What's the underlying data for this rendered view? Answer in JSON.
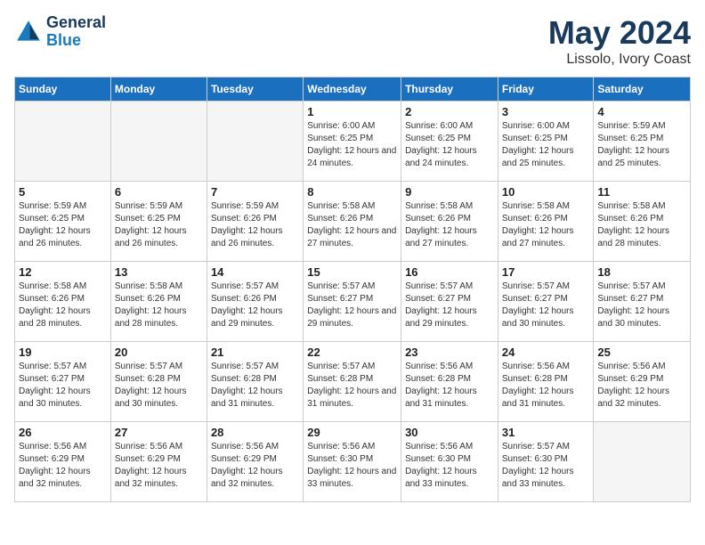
{
  "header": {
    "logo_line1": "General",
    "logo_line2": "Blue",
    "month": "May 2024",
    "location": "Lissolo, Ivory Coast"
  },
  "weekdays": [
    "Sunday",
    "Monday",
    "Tuesday",
    "Wednesday",
    "Thursday",
    "Friday",
    "Saturday"
  ],
  "weeks": [
    [
      {
        "day": "",
        "sunrise": "",
        "sunset": "",
        "daylight": ""
      },
      {
        "day": "",
        "sunrise": "",
        "sunset": "",
        "daylight": ""
      },
      {
        "day": "",
        "sunrise": "",
        "sunset": "",
        "daylight": ""
      },
      {
        "day": "1",
        "sunrise": "Sunrise: 6:00 AM",
        "sunset": "Sunset: 6:25 PM",
        "daylight": "Daylight: 12 hours and 24 minutes."
      },
      {
        "day": "2",
        "sunrise": "Sunrise: 6:00 AM",
        "sunset": "Sunset: 6:25 PM",
        "daylight": "Daylight: 12 hours and 24 minutes."
      },
      {
        "day": "3",
        "sunrise": "Sunrise: 6:00 AM",
        "sunset": "Sunset: 6:25 PM",
        "daylight": "Daylight: 12 hours and 25 minutes."
      },
      {
        "day": "4",
        "sunrise": "Sunrise: 5:59 AM",
        "sunset": "Sunset: 6:25 PM",
        "daylight": "Daylight: 12 hours and 25 minutes."
      }
    ],
    [
      {
        "day": "5",
        "sunrise": "Sunrise: 5:59 AM",
        "sunset": "Sunset: 6:25 PM",
        "daylight": "Daylight: 12 hours and 26 minutes."
      },
      {
        "day": "6",
        "sunrise": "Sunrise: 5:59 AM",
        "sunset": "Sunset: 6:25 PM",
        "daylight": "Daylight: 12 hours and 26 minutes."
      },
      {
        "day": "7",
        "sunrise": "Sunrise: 5:59 AM",
        "sunset": "Sunset: 6:26 PM",
        "daylight": "Daylight: 12 hours and 26 minutes."
      },
      {
        "day": "8",
        "sunrise": "Sunrise: 5:58 AM",
        "sunset": "Sunset: 6:26 PM",
        "daylight": "Daylight: 12 hours and 27 minutes."
      },
      {
        "day": "9",
        "sunrise": "Sunrise: 5:58 AM",
        "sunset": "Sunset: 6:26 PM",
        "daylight": "Daylight: 12 hours and 27 minutes."
      },
      {
        "day": "10",
        "sunrise": "Sunrise: 5:58 AM",
        "sunset": "Sunset: 6:26 PM",
        "daylight": "Daylight: 12 hours and 27 minutes."
      },
      {
        "day": "11",
        "sunrise": "Sunrise: 5:58 AM",
        "sunset": "Sunset: 6:26 PM",
        "daylight": "Daylight: 12 hours and 28 minutes."
      }
    ],
    [
      {
        "day": "12",
        "sunrise": "Sunrise: 5:58 AM",
        "sunset": "Sunset: 6:26 PM",
        "daylight": "Daylight: 12 hours and 28 minutes."
      },
      {
        "day": "13",
        "sunrise": "Sunrise: 5:58 AM",
        "sunset": "Sunset: 6:26 PM",
        "daylight": "Daylight: 12 hours and 28 minutes."
      },
      {
        "day": "14",
        "sunrise": "Sunrise: 5:57 AM",
        "sunset": "Sunset: 6:26 PM",
        "daylight": "Daylight: 12 hours and 29 minutes."
      },
      {
        "day": "15",
        "sunrise": "Sunrise: 5:57 AM",
        "sunset": "Sunset: 6:27 PM",
        "daylight": "Daylight: 12 hours and 29 minutes."
      },
      {
        "day": "16",
        "sunrise": "Sunrise: 5:57 AM",
        "sunset": "Sunset: 6:27 PM",
        "daylight": "Daylight: 12 hours and 29 minutes."
      },
      {
        "day": "17",
        "sunrise": "Sunrise: 5:57 AM",
        "sunset": "Sunset: 6:27 PM",
        "daylight": "Daylight: 12 hours and 30 minutes."
      },
      {
        "day": "18",
        "sunrise": "Sunrise: 5:57 AM",
        "sunset": "Sunset: 6:27 PM",
        "daylight": "Daylight: 12 hours and 30 minutes."
      }
    ],
    [
      {
        "day": "19",
        "sunrise": "Sunrise: 5:57 AM",
        "sunset": "Sunset: 6:27 PM",
        "daylight": "Daylight: 12 hours and 30 minutes."
      },
      {
        "day": "20",
        "sunrise": "Sunrise: 5:57 AM",
        "sunset": "Sunset: 6:28 PM",
        "daylight": "Daylight: 12 hours and 30 minutes."
      },
      {
        "day": "21",
        "sunrise": "Sunrise: 5:57 AM",
        "sunset": "Sunset: 6:28 PM",
        "daylight": "Daylight: 12 hours and 31 minutes."
      },
      {
        "day": "22",
        "sunrise": "Sunrise: 5:57 AM",
        "sunset": "Sunset: 6:28 PM",
        "daylight": "Daylight: 12 hours and 31 minutes."
      },
      {
        "day": "23",
        "sunrise": "Sunrise: 5:56 AM",
        "sunset": "Sunset: 6:28 PM",
        "daylight": "Daylight: 12 hours and 31 minutes."
      },
      {
        "day": "24",
        "sunrise": "Sunrise: 5:56 AM",
        "sunset": "Sunset: 6:28 PM",
        "daylight": "Daylight: 12 hours and 31 minutes."
      },
      {
        "day": "25",
        "sunrise": "Sunrise: 5:56 AM",
        "sunset": "Sunset: 6:29 PM",
        "daylight": "Daylight: 12 hours and 32 minutes."
      }
    ],
    [
      {
        "day": "26",
        "sunrise": "Sunrise: 5:56 AM",
        "sunset": "Sunset: 6:29 PM",
        "daylight": "Daylight: 12 hours and 32 minutes."
      },
      {
        "day": "27",
        "sunrise": "Sunrise: 5:56 AM",
        "sunset": "Sunset: 6:29 PM",
        "daylight": "Daylight: 12 hours and 32 minutes."
      },
      {
        "day": "28",
        "sunrise": "Sunrise: 5:56 AM",
        "sunset": "Sunset: 6:29 PM",
        "daylight": "Daylight: 12 hours and 32 minutes."
      },
      {
        "day": "29",
        "sunrise": "Sunrise: 5:56 AM",
        "sunset": "Sunset: 6:30 PM",
        "daylight": "Daylight: 12 hours and 33 minutes."
      },
      {
        "day": "30",
        "sunrise": "Sunrise: 5:56 AM",
        "sunset": "Sunset: 6:30 PM",
        "daylight": "Daylight: 12 hours and 33 minutes."
      },
      {
        "day": "31",
        "sunrise": "Sunrise: 5:57 AM",
        "sunset": "Sunset: 6:30 PM",
        "daylight": "Daylight: 12 hours and 33 minutes."
      },
      {
        "day": "",
        "sunrise": "",
        "sunset": "",
        "daylight": ""
      }
    ]
  ]
}
